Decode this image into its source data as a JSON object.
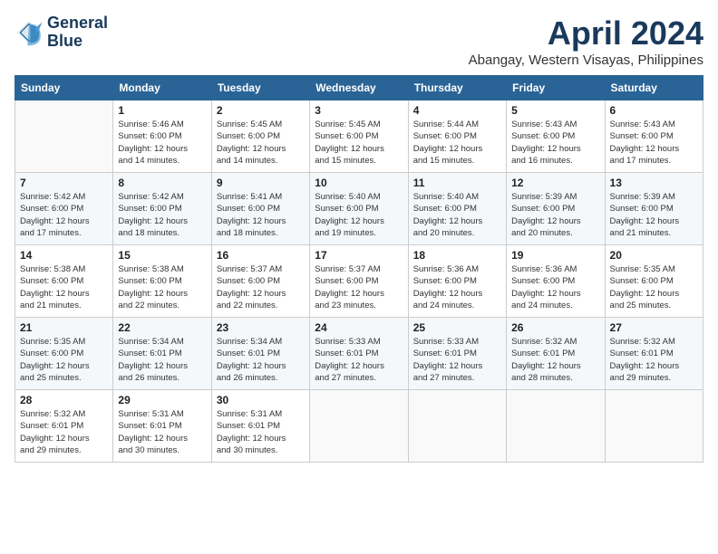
{
  "logo": {
    "line1": "General",
    "line2": "Blue"
  },
  "title": "April 2024",
  "location": "Abangay, Western Visayas, Philippines",
  "days_of_week": [
    "Sunday",
    "Monday",
    "Tuesday",
    "Wednesday",
    "Thursday",
    "Friday",
    "Saturday"
  ],
  "weeks": [
    [
      {
        "day": "",
        "info": ""
      },
      {
        "day": "1",
        "info": "Sunrise: 5:46 AM\nSunset: 6:00 PM\nDaylight: 12 hours\nand 14 minutes."
      },
      {
        "day": "2",
        "info": "Sunrise: 5:45 AM\nSunset: 6:00 PM\nDaylight: 12 hours\nand 14 minutes."
      },
      {
        "day": "3",
        "info": "Sunrise: 5:45 AM\nSunset: 6:00 PM\nDaylight: 12 hours\nand 15 minutes."
      },
      {
        "day": "4",
        "info": "Sunrise: 5:44 AM\nSunset: 6:00 PM\nDaylight: 12 hours\nand 15 minutes."
      },
      {
        "day": "5",
        "info": "Sunrise: 5:43 AM\nSunset: 6:00 PM\nDaylight: 12 hours\nand 16 minutes."
      },
      {
        "day": "6",
        "info": "Sunrise: 5:43 AM\nSunset: 6:00 PM\nDaylight: 12 hours\nand 17 minutes."
      }
    ],
    [
      {
        "day": "7",
        "info": "Sunrise: 5:42 AM\nSunset: 6:00 PM\nDaylight: 12 hours\nand 17 minutes."
      },
      {
        "day": "8",
        "info": "Sunrise: 5:42 AM\nSunset: 6:00 PM\nDaylight: 12 hours\nand 18 minutes."
      },
      {
        "day": "9",
        "info": "Sunrise: 5:41 AM\nSunset: 6:00 PM\nDaylight: 12 hours\nand 18 minutes."
      },
      {
        "day": "10",
        "info": "Sunrise: 5:40 AM\nSunset: 6:00 PM\nDaylight: 12 hours\nand 19 minutes."
      },
      {
        "day": "11",
        "info": "Sunrise: 5:40 AM\nSunset: 6:00 PM\nDaylight: 12 hours\nand 20 minutes."
      },
      {
        "day": "12",
        "info": "Sunrise: 5:39 AM\nSunset: 6:00 PM\nDaylight: 12 hours\nand 20 minutes."
      },
      {
        "day": "13",
        "info": "Sunrise: 5:39 AM\nSunset: 6:00 PM\nDaylight: 12 hours\nand 21 minutes."
      }
    ],
    [
      {
        "day": "14",
        "info": "Sunrise: 5:38 AM\nSunset: 6:00 PM\nDaylight: 12 hours\nand 21 minutes."
      },
      {
        "day": "15",
        "info": "Sunrise: 5:38 AM\nSunset: 6:00 PM\nDaylight: 12 hours\nand 22 minutes."
      },
      {
        "day": "16",
        "info": "Sunrise: 5:37 AM\nSunset: 6:00 PM\nDaylight: 12 hours\nand 22 minutes."
      },
      {
        "day": "17",
        "info": "Sunrise: 5:37 AM\nSunset: 6:00 PM\nDaylight: 12 hours\nand 23 minutes."
      },
      {
        "day": "18",
        "info": "Sunrise: 5:36 AM\nSunset: 6:00 PM\nDaylight: 12 hours\nand 24 minutes."
      },
      {
        "day": "19",
        "info": "Sunrise: 5:36 AM\nSunset: 6:00 PM\nDaylight: 12 hours\nand 24 minutes."
      },
      {
        "day": "20",
        "info": "Sunrise: 5:35 AM\nSunset: 6:00 PM\nDaylight: 12 hours\nand 25 minutes."
      }
    ],
    [
      {
        "day": "21",
        "info": "Sunrise: 5:35 AM\nSunset: 6:00 PM\nDaylight: 12 hours\nand 25 minutes."
      },
      {
        "day": "22",
        "info": "Sunrise: 5:34 AM\nSunset: 6:01 PM\nDaylight: 12 hours\nand 26 minutes."
      },
      {
        "day": "23",
        "info": "Sunrise: 5:34 AM\nSunset: 6:01 PM\nDaylight: 12 hours\nand 26 minutes."
      },
      {
        "day": "24",
        "info": "Sunrise: 5:33 AM\nSunset: 6:01 PM\nDaylight: 12 hours\nand 27 minutes."
      },
      {
        "day": "25",
        "info": "Sunrise: 5:33 AM\nSunset: 6:01 PM\nDaylight: 12 hours\nand 27 minutes."
      },
      {
        "day": "26",
        "info": "Sunrise: 5:32 AM\nSunset: 6:01 PM\nDaylight: 12 hours\nand 28 minutes."
      },
      {
        "day": "27",
        "info": "Sunrise: 5:32 AM\nSunset: 6:01 PM\nDaylight: 12 hours\nand 29 minutes."
      }
    ],
    [
      {
        "day": "28",
        "info": "Sunrise: 5:32 AM\nSunset: 6:01 PM\nDaylight: 12 hours\nand 29 minutes."
      },
      {
        "day": "29",
        "info": "Sunrise: 5:31 AM\nSunset: 6:01 PM\nDaylight: 12 hours\nand 30 minutes."
      },
      {
        "day": "30",
        "info": "Sunrise: 5:31 AM\nSunset: 6:01 PM\nDaylight: 12 hours\nand 30 minutes."
      },
      {
        "day": "",
        "info": ""
      },
      {
        "day": "",
        "info": ""
      },
      {
        "day": "",
        "info": ""
      },
      {
        "day": "",
        "info": ""
      }
    ]
  ]
}
